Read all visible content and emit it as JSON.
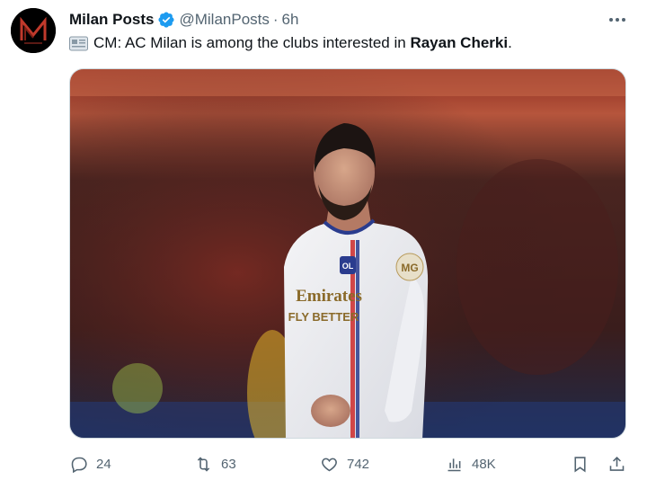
{
  "tweet": {
    "author_name": "Milan Posts",
    "handle": "@MilanPosts",
    "separator": "·",
    "time": "6h",
    "text_prefix": "CM: AC Milan is among the clubs interested in ",
    "text_bold": "Rayan Cherki",
    "text_suffix": ".",
    "stats": {
      "replies": "24",
      "reposts": "63",
      "likes": "742",
      "views": "48K"
    }
  },
  "media": {
    "shirt_sponsor_line1": "Emirates",
    "shirt_sponsor_line2": "FLY BETTER",
    "badge_text": "OL",
    "sleeve_text": "MG"
  },
  "colors": {
    "verified_blue": "#1d9bf0",
    "secondary_text": "#536471",
    "primary_text": "#0f1419"
  },
  "icons": [
    "more-icon",
    "verified-badge-icon",
    "newspaper-icon",
    "reply-icon",
    "repost-icon",
    "like-icon",
    "views-icon",
    "bookmark-icon",
    "share-icon"
  ]
}
